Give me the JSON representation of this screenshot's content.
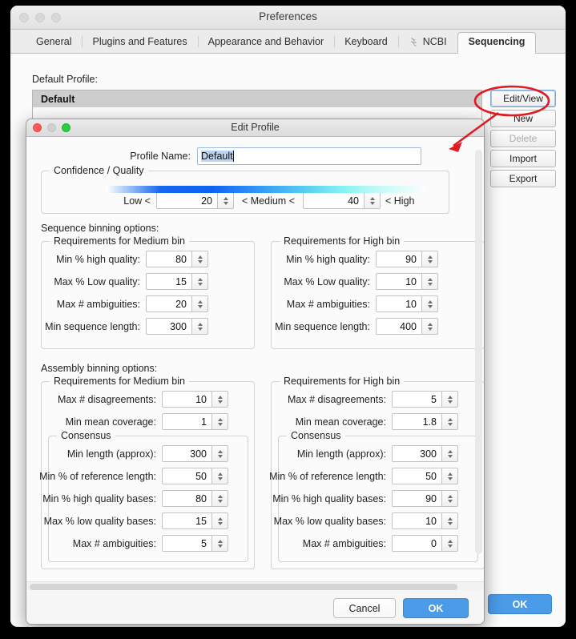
{
  "prefs_window": {
    "title": "Preferences",
    "traffic_lights": [
      "close-grey",
      "minimize-grey",
      "zoom-grey"
    ],
    "tabs": [
      {
        "label": "General",
        "active": false,
        "icon": null
      },
      {
        "label": "Plugins and Features",
        "active": false,
        "icon": null
      },
      {
        "label": "Appearance and Behavior",
        "active": false,
        "icon": null
      },
      {
        "label": "Keyboard",
        "active": false,
        "icon": null
      },
      {
        "label": "NCBI",
        "active": false,
        "icon": "dna-helix-icon"
      },
      {
        "label": "Sequencing",
        "active": true,
        "icon": null
      }
    ],
    "default_profile_label": "Default Profile:",
    "profile_rows": [
      "Default"
    ],
    "side_buttons": [
      {
        "label": "Edit/View",
        "state": "focused"
      },
      {
        "label": "New",
        "state": "normal"
      },
      {
        "label": "Delete",
        "state": "disabled"
      },
      {
        "label": "Import",
        "state": "normal"
      },
      {
        "label": "Export",
        "state": "normal"
      }
    ],
    "ok_label": "OK"
  },
  "edit_dialog": {
    "title": "Edit Profile",
    "traffic_lights": [
      "close-red",
      "minimize-grey",
      "zoom-green"
    ],
    "profile_name": {
      "label": "Profile Name:",
      "value": "Default",
      "selected": true
    },
    "confidence": {
      "group_title": "Confidence / Quality",
      "low_label": "Low <",
      "low_value": "20",
      "mid_label": "< Medium <",
      "high_value": "40",
      "high_label": "< High"
    },
    "sequence_binning": {
      "section_label": "Sequence binning options:",
      "medium": {
        "group_title": "Requirements for Medium bin",
        "fields": [
          {
            "label": "Min % high quality:",
            "value": "80"
          },
          {
            "label": "Max % Low quality:",
            "value": "15"
          },
          {
            "label": "Max # ambiguities:",
            "value": "20"
          },
          {
            "label": "Min sequence length:",
            "value": "300"
          }
        ]
      },
      "high": {
        "group_title": "Requirements for High bin",
        "fields": [
          {
            "label": "Min % high quality:",
            "value": "90"
          },
          {
            "label": "Max % Low quality:",
            "value": "10"
          },
          {
            "label": "Max # ambiguities:",
            "value": "10"
          },
          {
            "label": "Min sequence length:",
            "value": "400"
          }
        ]
      }
    },
    "assembly_binning": {
      "section_label": "Assembly binning options:",
      "medium": {
        "group_title": "Requirements for Medium bin",
        "fields": [
          {
            "label": "Max # disagreements:",
            "value": "10"
          },
          {
            "label": "Min mean coverage:",
            "value": "1"
          }
        ],
        "consensus": {
          "group_title": "Consensus",
          "fields": [
            {
              "label": "Min length (approx):",
              "value": "300"
            },
            {
              "label": "Min % of reference length:",
              "value": "50"
            },
            {
              "label": "Min % high quality bases:",
              "value": "80"
            },
            {
              "label": "Max % low quality bases:",
              "value": "15"
            },
            {
              "label": "Max # ambiguities:",
              "value": "5"
            }
          ]
        }
      },
      "high": {
        "group_title": "Requirements for High bin",
        "fields": [
          {
            "label": "Max # disagreements:",
            "value": "5"
          },
          {
            "label": "Min mean coverage:",
            "value": "1.8"
          }
        ],
        "consensus": {
          "group_title": "Consensus",
          "fields": [
            {
              "label": "Min length (approx):",
              "value": "300"
            },
            {
              "label": "Min % of reference length:",
              "value": "50"
            },
            {
              "label": "Min % high quality bases:",
              "value": "90"
            },
            {
              "label": "Max % low quality bases:",
              "value": "10"
            },
            {
              "label": "Max # ambiguities:",
              "value": "0"
            }
          ]
        }
      }
    },
    "footer": {
      "cancel_label": "Cancel",
      "ok_label": "OK"
    }
  },
  "annotation": {
    "color": "#e01b22",
    "ellipse_target": "Edit/View",
    "arrow_points_to": "Edit Profile dialog"
  }
}
